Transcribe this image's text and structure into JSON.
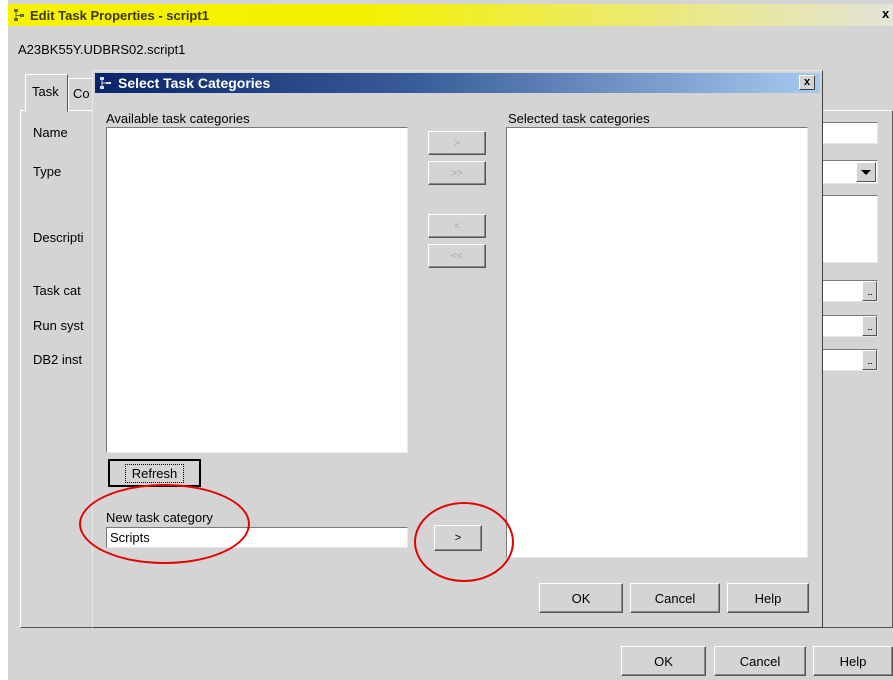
{
  "outer_window": {
    "title": "Edit Task Properties - script1",
    "subtitle": "A23BK55Y.UDBRS02.script1",
    "tabs": [
      "Task",
      "Co"
    ],
    "field_labels": {
      "name": "Name",
      "type": "Type",
      "description": "Descripti",
      "task_category": "Task cat",
      "run_system": "Run syst",
      "db2_instance": "DB2 inst"
    },
    "browse_glyph": "...",
    "close_glyph": "x",
    "buttons": {
      "ok": "OK",
      "cancel": "Cancel",
      "help": "Help"
    }
  },
  "dialog": {
    "title": "Select Task Categories",
    "close_glyph": "x",
    "available_label": "Available task categories",
    "selected_label": "Selected task categories",
    "move_buttons": {
      "add": ">",
      "add_all": ">>",
      "remove": "<",
      "remove_all": "<<"
    },
    "refresh_label": "Refresh",
    "new_category_label": "New task category",
    "new_category_value": "Scripts",
    "add_new_button": ">",
    "buttons": {
      "ok": "OK",
      "cancel": "Cancel",
      "help": "Help"
    }
  },
  "colors": {
    "outer_title_bar": "#f7f200",
    "dialog_title_start": "#0a246a",
    "dialog_title_end": "#a6caf0",
    "window_bg": "#d4d4d4",
    "annotation": "#e60000"
  }
}
